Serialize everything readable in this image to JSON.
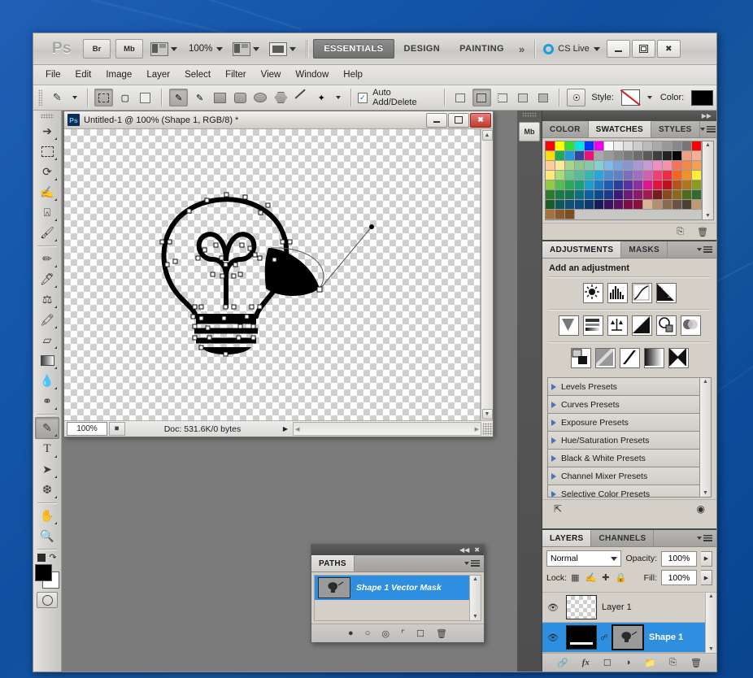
{
  "app": {
    "logo": "Ps",
    "bridge_label": "Br",
    "minibridge_label": "Mb",
    "zoom_level": "100%",
    "workspaces": [
      {
        "label": "ESSENTIALS",
        "active": true
      },
      {
        "label": "DESIGN",
        "active": false
      },
      {
        "label": "PAINTING",
        "active": false
      }
    ],
    "more_workspaces": "»",
    "cs_live": "CS Live",
    "window_buttons": [
      "minimize",
      "restore",
      "close"
    ]
  },
  "menubar": [
    "File",
    "Edit",
    "Image",
    "Layer",
    "Select",
    "Filter",
    "View",
    "Window",
    "Help"
  ],
  "options_bar": {
    "active_tool_icon": "pen-tool-icon",
    "mode_buttons": [
      "shape-layers-icon",
      "paths-icon",
      "fill-pixels-icon"
    ],
    "tool_buttons": [
      "pen-tool-icon",
      "freeform-pen-icon",
      "rectangle-icon",
      "rounded-rectangle-icon",
      "ellipse-icon",
      "polygon-icon",
      "line-icon",
      "custom-shape-icon"
    ],
    "auto_add_delete_label": "Auto Add/Delete",
    "auto_add_delete_checked": true,
    "path_ops": [
      "add-to-shape-icon",
      "subtract-from-shape-icon",
      "intersect-shape-icon",
      "exclude-shape-icon"
    ],
    "style_label": "Style:",
    "style_value": "none",
    "color_label": "Color:",
    "color_value": "#000000"
  },
  "tools": [
    {
      "name": "move-tool",
      "glyph": "↖",
      "selected": false
    },
    {
      "name": "marquee-tool",
      "glyph": "⬚",
      "selected": false
    },
    {
      "name": "lasso-tool",
      "glyph": "⌀",
      "selected": false
    },
    {
      "name": "quick-selection-tool",
      "glyph": "✎",
      "selected": false
    },
    {
      "name": "crop-tool",
      "glyph": "⌗",
      "selected": false
    },
    {
      "name": "eyedropper-tool",
      "glyph": "✒",
      "selected": false
    },
    {
      "name": "spot-healing-brush-tool",
      "glyph": "❁",
      "selected": false
    },
    {
      "name": "brush-tool",
      "glyph": "✏",
      "selected": false
    },
    {
      "name": "clone-stamp-tool",
      "glyph": "⚓",
      "selected": false
    },
    {
      "name": "history-brush-tool",
      "glyph": "✒",
      "selected": false
    },
    {
      "name": "eraser-tool",
      "glyph": "▱",
      "selected": false
    },
    {
      "name": "gradient-tool",
      "glyph": "▨",
      "selected": false
    },
    {
      "name": "blur-tool",
      "glyph": "●",
      "selected": false
    },
    {
      "name": "dodge-tool",
      "glyph": "⚲",
      "selected": false
    },
    {
      "name": "pen-tool",
      "glyph": "✑",
      "selected": true
    },
    {
      "name": "horizontal-type-tool",
      "glyph": "T",
      "selected": false
    },
    {
      "name": "path-selection-tool",
      "glyph": "▶",
      "selected": false
    },
    {
      "name": "custom-shape-tool",
      "glyph": "✦",
      "selected": false
    },
    {
      "name": "hand-tool",
      "glyph": "✋",
      "selected": false
    },
    {
      "name": "zoom-tool",
      "glyph": "⌕",
      "selected": false
    }
  ],
  "colors": {
    "foreground": "#000000",
    "background": "#ffffff",
    "selection_blue": "#2e8fe0",
    "desktop_blue": "#0f4fa0",
    "workspace_gray": "#7b7b7b",
    "panel_gray": "#d4d0c8"
  },
  "document": {
    "title": "Untitled-1 @ 100% (Shape 1, RGB/8) *",
    "window_buttons": [
      "minimize",
      "restore",
      "close"
    ],
    "status": {
      "zoom": "100%",
      "doc_info": "Doc: 531.6K/0 bytes"
    }
  },
  "swatches_panel": {
    "tabs": [
      {
        "label": "COLOR",
        "active": false
      },
      {
        "label": "SWATCHES",
        "active": true
      },
      {
        "label": "STYLES",
        "active": false
      }
    ],
    "grid": [
      "#ff0000",
      "#ffff00",
      "#33dd33",
      "#00e5e5",
      "#0033ff",
      "#ee00ee",
      "#ffffff",
      "#ededed",
      "#dddddd",
      "#cccccc",
      "#bbbbbb",
      "#aaaaaa",
      "#999999",
      "#888888",
      "#777777",
      "#ff0000",
      "#ffdd00",
      "#22aa55",
      "#2299dd",
      "#33449f",
      "#ee1177",
      "#a8a8a8",
      "#9a9a9a",
      "#8a8a8a",
      "#7c7c7c",
      "#6d6d6d",
      "#5a5a5a",
      "#3f3f3f",
      "#222222",
      "#000000",
      "#f0a080",
      "#f4b090",
      "#ffcc99",
      "#ffe899",
      "#a8d78a",
      "#8fc88f",
      "#86c9a9",
      "#86cfd2",
      "#7fb9e8",
      "#7aa6dd",
      "#8b96cc",
      "#a898d6",
      "#c69cd8",
      "#ef8fc0",
      "#f494a8",
      "#f4735a",
      "#f08a4a",
      "#f0a050",
      "#ffe77a",
      "#aadd77",
      "#6fc68a",
      "#55bb9a",
      "#36b5b5",
      "#2aa6dd",
      "#4f8fd0",
      "#5f82c2",
      "#7a6fb8",
      "#a06fc0",
      "#d061b0",
      "#ee3f7a",
      "#ee2b3f",
      "#f4651f",
      "#f4902a",
      "#ffee33",
      "#8fcc44",
      "#55bb55",
      "#2aa855",
      "#1b9e7b",
      "#1b9ec8",
      "#1b7bc4",
      "#1b5fb5",
      "#2a3f9e",
      "#5a33a0",
      "#8b2f9e",
      "#e0148e",
      "#e0143f",
      "#c01020",
      "#b2561e",
      "#b2741e",
      "#8a9a22",
      "#2f7a33",
      "#1b7a4a",
      "#15734f",
      "#0f6f80",
      "#0f5f9e",
      "#0f4a8e",
      "#1b3a8a",
      "#3b1b7a",
      "#6b1b7a",
      "#8a1b6b",
      "#a01b4f",
      "#7a1b1b",
      "#8a4a1b",
      "#8a6b1b",
      "#4f6b1b",
      "#2f6b2f",
      "#1f5a2a",
      "#10595a",
      "#0f4f7a",
      "#0d4a7a",
      "#0d3a6b",
      "#161b5a",
      "#3a1160",
      "#5a1060",
      "#7a0f4a",
      "#8a0f3a",
      "#d8b790",
      "#b59070",
      "#8a6b4f",
      "#6b5440",
      "#4f3f30",
      "#c09a72",
      "#a8703a",
      "#8a5a2a",
      "#7a4f22",
      "",
      "",
      "",
      "",
      "",
      "",
      "",
      "",
      "",
      "",
      "",
      "",
      ""
    ]
  },
  "adjustments_panel": {
    "tabs": [
      {
        "label": "ADJUSTMENTS",
        "active": true
      },
      {
        "label": "MASKS",
        "active": false
      }
    ],
    "heading": "Add an adjustment",
    "icons_row1": [
      "brightness-contrast-icon",
      "levels-icon",
      "curves-icon",
      "exposure-icon"
    ],
    "icons_row2": [
      "vibrance-icon",
      "hue-saturation-icon",
      "color-balance-icon",
      "black-white-icon",
      "photo-filter-icon",
      "channel-mixer-icon"
    ],
    "icons_row3": [
      "invert-icon",
      "posterize-icon",
      "threshold-icon",
      "gradient-map-icon",
      "selective-color-icon"
    ],
    "presets": [
      "Levels Presets",
      "Curves Presets",
      "Exposure Presets",
      "Hue/Saturation Presets",
      "Black & White Presets",
      "Channel Mixer Presets",
      "Selective Color Presets"
    ],
    "footer_icons": [
      "return-to-adjustment-list-icon",
      "view-previous-state-icon"
    ]
  },
  "paths_panel": {
    "tabs": [
      {
        "label": "PATHS",
        "active": true
      }
    ],
    "rows": [
      {
        "name": "Shape 1 Vector Mask",
        "selected": true
      }
    ],
    "footer_icons": [
      "fill-path-icon",
      "stroke-path-icon",
      "load-selection-icon",
      "make-work-path-icon",
      "new-path-icon",
      "delete-path-icon"
    ]
  },
  "layers_panel": {
    "tabs": [
      {
        "label": "LAYERS",
        "active": true
      },
      {
        "label": "CHANNELS",
        "active": false
      }
    ],
    "blend_mode": "Normal",
    "opacity_label": "Opacity:",
    "opacity_value": "100%",
    "lock_label": "Lock:",
    "lock_icons": [
      "lock-transparent-pixels-icon",
      "lock-image-pixels-icon",
      "lock-position-icon",
      "lock-all-icon"
    ],
    "fill_label": "Fill:",
    "fill_value": "100%",
    "rows": [
      {
        "name": "Layer 1",
        "selected": false,
        "thumb": "checker",
        "visible": true
      },
      {
        "name": "Shape 1",
        "selected": true,
        "thumb": "black",
        "visible": true,
        "has_mask": true
      }
    ],
    "footer_icons": [
      "link-layers-icon",
      "layer-style-icon",
      "layer-mask-icon",
      "adjustment-layer-icon",
      "new-group-icon",
      "new-layer-icon",
      "delete-layer-icon"
    ]
  },
  "minidock": {
    "buttons": [
      "mini-bridge-icon"
    ],
    "mini_bridge_label": "Mb"
  }
}
